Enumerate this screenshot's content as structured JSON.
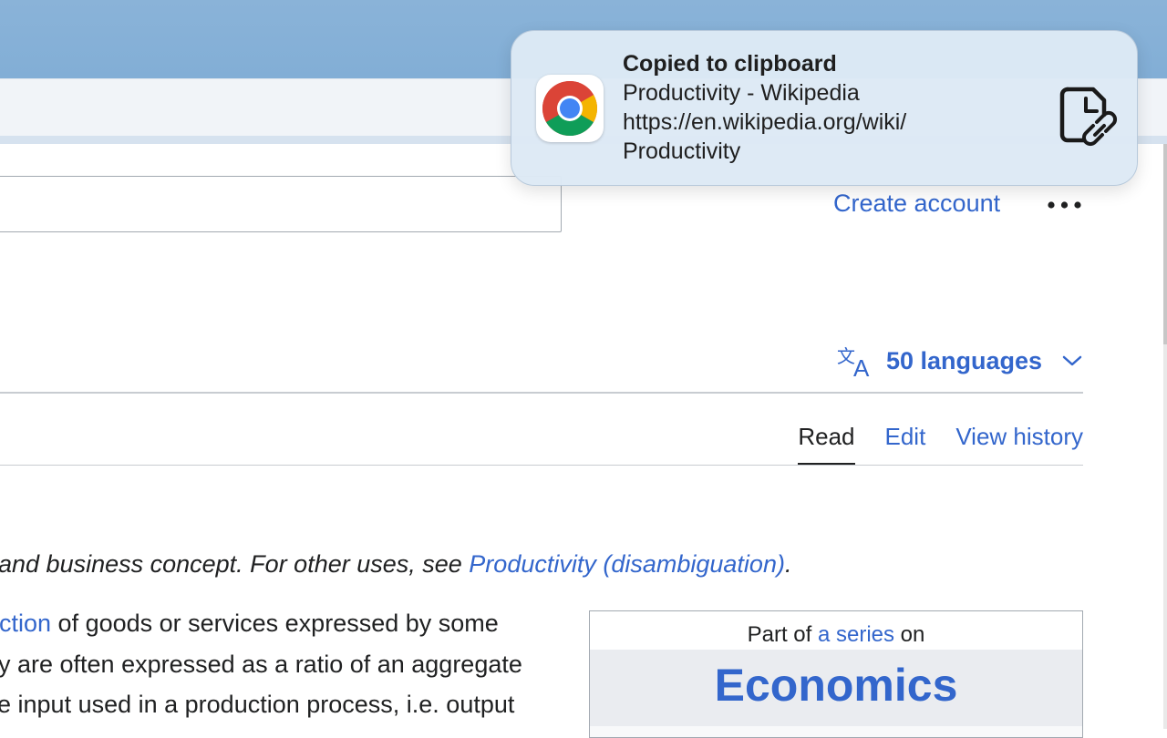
{
  "header": {
    "create_account": "Create account",
    "more_icon": "more-horizontal-icon"
  },
  "languages": {
    "icon": "translate-icon",
    "label": "50 languages",
    "chevron": "chevron-down-icon"
  },
  "tabs": [
    {
      "label": "Read",
      "active": true
    },
    {
      "label": "Edit",
      "active": false
    },
    {
      "label": "View history",
      "active": false
    }
  ],
  "hatnote": {
    "prefix": "and business concept. For other uses, see ",
    "link": "Productivity (disambiguation)",
    "suffix": "."
  },
  "body": {
    "line1_link": "ction",
    "line1_text": " of goods or services expressed by some",
    "line2": "y are often expressed as a ratio of an aggregate",
    "line3": "e input used in a production process, i.e. output"
  },
  "infobox": {
    "part_of_prefix": "Part of ",
    "part_of_link": "a series",
    "part_of_suffix": " on",
    "title": "Economics"
  },
  "notification": {
    "app_icon": "chrome-icon",
    "title": "Copied to clipboard",
    "page_title": "Productivity - Wikipedia",
    "url_line1": "https://en.wikipedia.org/wiki/",
    "url_line2": "Productivity",
    "action_icon": "clipboard-link-icon"
  },
  "colors": {
    "link": "#3366cc",
    "text": "#202122",
    "tabbar": "#85b0d7"
  }
}
